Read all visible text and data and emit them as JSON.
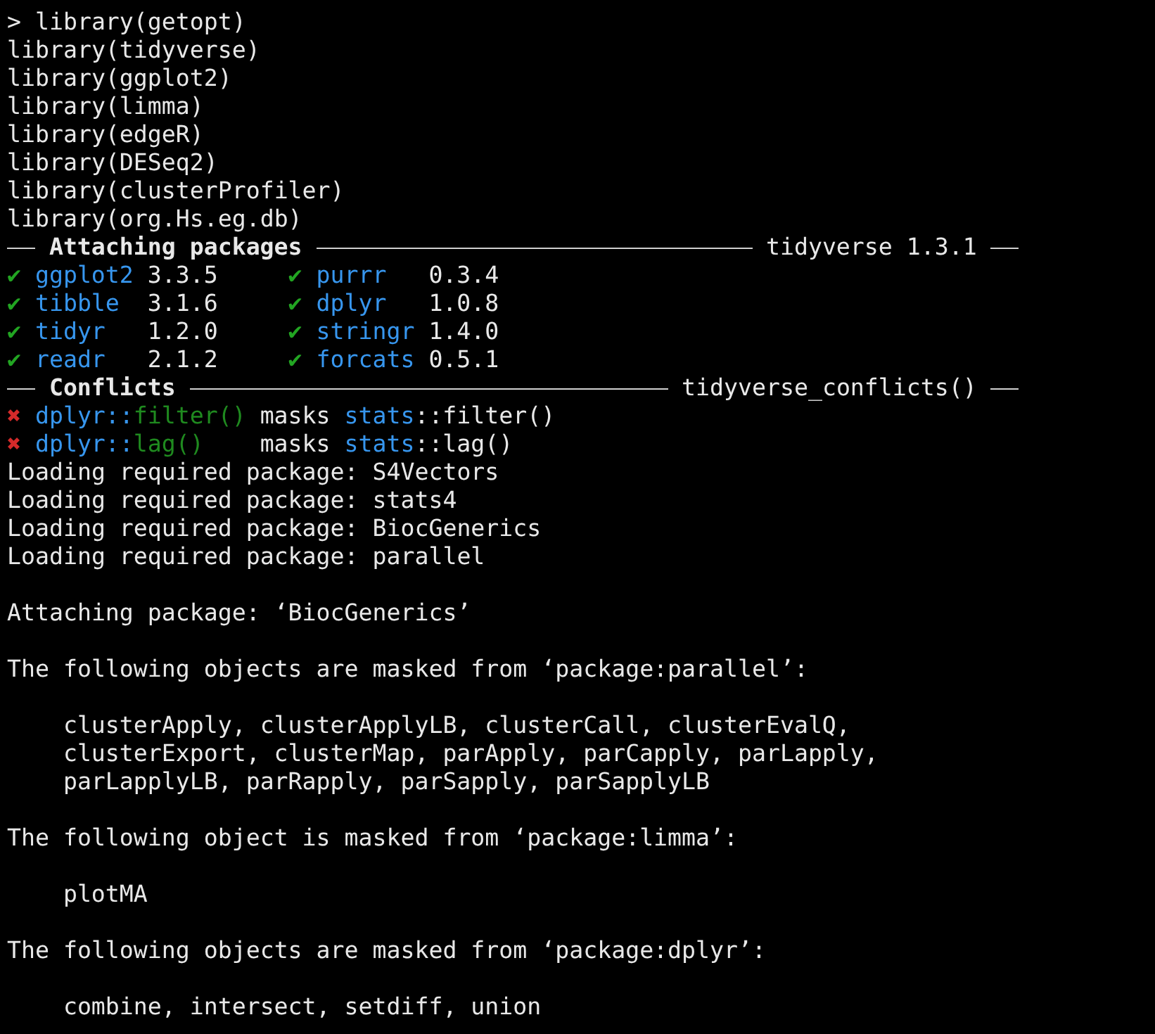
{
  "commands": [
    {
      "prompt": ">",
      "text": "library(getopt)"
    },
    {
      "text": "library(tidyverse)"
    },
    {
      "text": "library(ggplot2)"
    },
    {
      "text": "library(limma)"
    },
    {
      "text": "library(edgeR)"
    },
    {
      "text": "library(DESeq2)"
    },
    {
      "text": "library(clusterProfiler)"
    },
    {
      "text": "library(org.Hs.eg.db)"
    }
  ],
  "attach_header": {
    "title": "Attaching packages",
    "info": "tidyverse 1.3.1"
  },
  "packages": [
    {
      "mark": "✔",
      "name": "ggplot2",
      "version": "3.3.5"
    },
    {
      "mark": "✔",
      "name": "purrr",
      "version": "0.3.4"
    },
    {
      "mark": "✔",
      "name": "tibble",
      "version": "3.1.6"
    },
    {
      "mark": "✔",
      "name": "dplyr",
      "version": "1.0.8"
    },
    {
      "mark": "✔",
      "name": "tidyr",
      "version": "1.2.0"
    },
    {
      "mark": "✔",
      "name": "stringr",
      "version": "1.4.0"
    },
    {
      "mark": "✔",
      "name": "readr",
      "version": "2.1.2"
    },
    {
      "mark": "✔",
      "name": "forcats",
      "version": "0.5.1"
    }
  ],
  "conflicts_header": {
    "title": "Conflicts",
    "info": "tidyverse_conflicts()"
  },
  "conflicts": [
    {
      "mark": "✖",
      "package": "dplyr::",
      "function": "filter()",
      "verb": "masks",
      "masked_package": "stats",
      "masked_function": "::filter()"
    },
    {
      "mark": "✖",
      "package": "dplyr::",
      "function": "lag()",
      "verb": "masks",
      "masked_package": "stats",
      "masked_function": "::lag()"
    }
  ],
  "output": [
    {
      "indent": false,
      "lines": [
        "Loading required package: S4Vectors",
        "Loading required package: stats4",
        "Loading required package: BiocGenerics",
        "Loading required package: parallel"
      ]
    },
    {
      "indent": false,
      "lines": [
        "Attaching package: ‘BiocGenerics’"
      ]
    },
    {
      "indent": false,
      "lines": [
        "The following objects are masked from ‘package:parallel’:"
      ]
    },
    {
      "indent": true,
      "lines": [
        "clusterApply, clusterApplyLB, clusterCall, clusterEvalQ,",
        "clusterExport, clusterMap, parApply, parCapply, parLapply,",
        "parLapplyLB, parRapply, parSapply, parSapplyLB"
      ]
    },
    {
      "indent": false,
      "lines": [
        "The following object is masked from ‘package:limma’:"
      ]
    },
    {
      "indent": true,
      "lines": [
        "plotMA"
      ]
    },
    {
      "indent": false,
      "lines": [
        "The following objects are masked from ‘package:dplyr’:"
      ]
    },
    {
      "indent": true,
      "lines": [
        "combine, intersect, setdiff, union"
      ]
    }
  ]
}
